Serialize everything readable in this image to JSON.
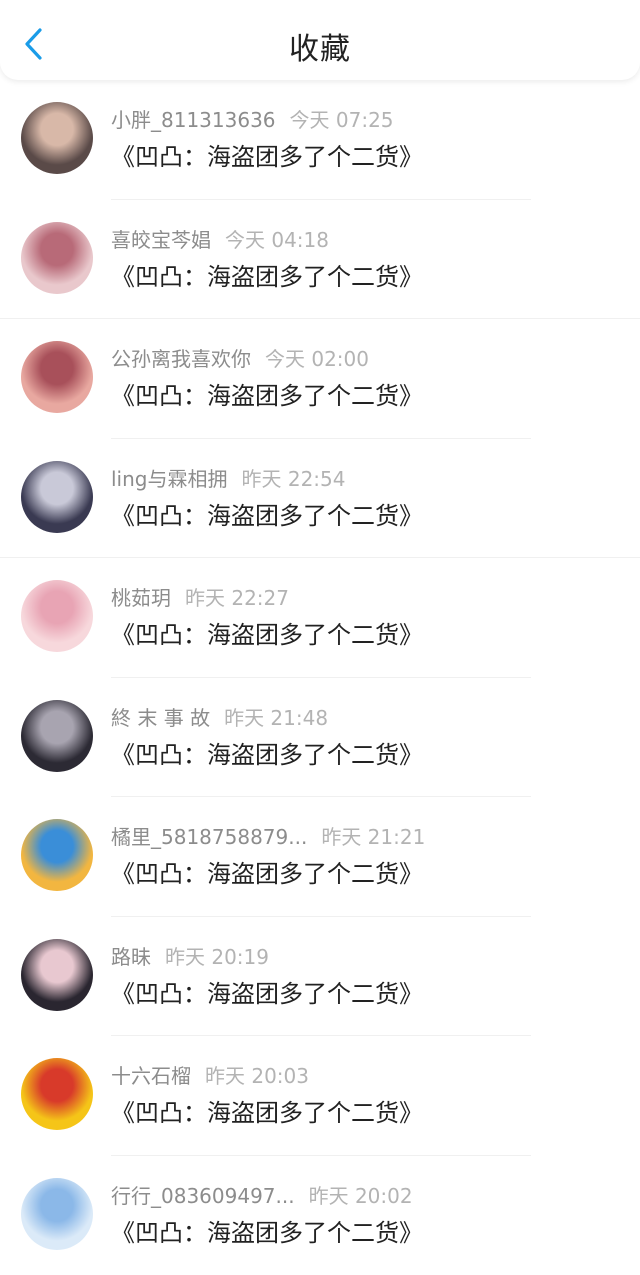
{
  "header": {
    "title": "收藏",
    "back_icon": "chevron-left-icon",
    "accent": "#1a9ce8"
  },
  "items": [
    {
      "name": "小胖_811313636",
      "time": "今天 07:25",
      "text": "《凹凸：海盗团多了个二货》",
      "avatar": "avatar-photo",
      "colors": [
        "#5a4a48",
        "#d8b8a8"
      ]
    },
    {
      "name": "喜皎宝芩娼",
      "time": "今天 04:18",
      "text": "《凹凸：海盗团多了个二货》",
      "avatar": "avatar-anime",
      "colors": [
        "#e9c8cc",
        "#b86a78"
      ]
    },
    {
      "name": "公孙离我喜欢你",
      "time": "今天 02:00",
      "text": "《凹凸：海盗团多了个二货》",
      "avatar": "avatar-anime",
      "colors": [
        "#e8a8a0",
        "#a8505a"
      ]
    },
    {
      "name": "ling与霖相拥",
      "time": "昨天 22:54",
      "text": "《凹凸：海盗团多了个二货》",
      "avatar": "avatar-anime",
      "colors": [
        "#3a3a52",
        "#c9c9d8"
      ]
    },
    {
      "name": "桃茹玥",
      "time": "昨天 22:27",
      "text": "《凹凸：海盗团多了个二货》",
      "avatar": "avatar-anime",
      "colors": [
        "#f7d8dc",
        "#e8a4b4"
      ]
    },
    {
      "name": "終 末 事 故",
      "time": "昨天 21:48",
      "text": "《凹凸：海盗团多了个二货》",
      "avatar": "avatar-anime",
      "colors": [
        "#2c2a34",
        "#a8a4b0"
      ]
    },
    {
      "name": "橘里_5818758879...",
      "time": "昨天 21:21",
      "text": "《凹凸：海盗团多了个二货》",
      "avatar": "avatar-anime",
      "colors": [
        "#f2b640",
        "#3a8ed8"
      ]
    },
    {
      "name": "路昧",
      "time": "昨天 20:19",
      "text": "《凹凸：海盗团多了个二货》",
      "avatar": "avatar-anime",
      "colors": [
        "#2a2630",
        "#e8c8d0"
      ]
    },
    {
      "name": "十六石榴",
      "time": "昨天 20:03",
      "text": "《凹凸：海盗团多了个二货》",
      "avatar": "avatar-pixel",
      "colors": [
        "#f5c518",
        "#d83a2a"
      ]
    },
    {
      "name": "行行_083609497...",
      "time": "昨天 20:02",
      "text": "《凹凸：海盗团多了个二货》",
      "avatar": "avatar-anime",
      "colors": [
        "#dbeaf8",
        "#8bb8e8"
      ]
    }
  ]
}
